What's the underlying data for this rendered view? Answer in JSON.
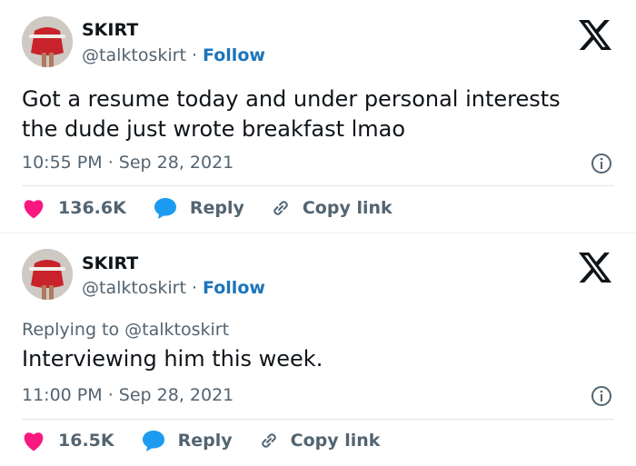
{
  "tweets": [
    {
      "author_name": "SKIRT",
      "handle": "@talktoskirt",
      "separator": "·",
      "follow_label": "Follow",
      "replying_prefix": "",
      "replying_to": "",
      "text_lines": [
        "Got a resume today and under personal interests",
        "the dude just wrote breakfast lmao"
      ],
      "time": "10:55 PM",
      "date": "Sep 28, 2021",
      "likes": "136.6K",
      "reply_label": "Reply",
      "copy_label": "Copy link"
    },
    {
      "author_name": "SKIRT",
      "handle": "@talktoskirt",
      "separator": "·",
      "follow_label": "Follow",
      "replying_prefix": "Replying to",
      "replying_to": "@talktoskirt",
      "text_lines": [
        "Interviewing him this week."
      ],
      "time": "11:00 PM",
      "date": "Sep 28, 2021",
      "likes": "16.5K",
      "reply_label": "Reply",
      "copy_label": "Copy link"
    }
  ],
  "icons": {
    "logo": "x-logo-icon",
    "info": "info-icon",
    "like": "heart-icon",
    "reply": "chat-bubble-icon",
    "copy": "link-icon"
  },
  "colors": {
    "like": "#f91880",
    "reply": "#1d9bf0",
    "follow": "#1d74bb",
    "muted": "#536471",
    "text": "#0f1419"
  }
}
